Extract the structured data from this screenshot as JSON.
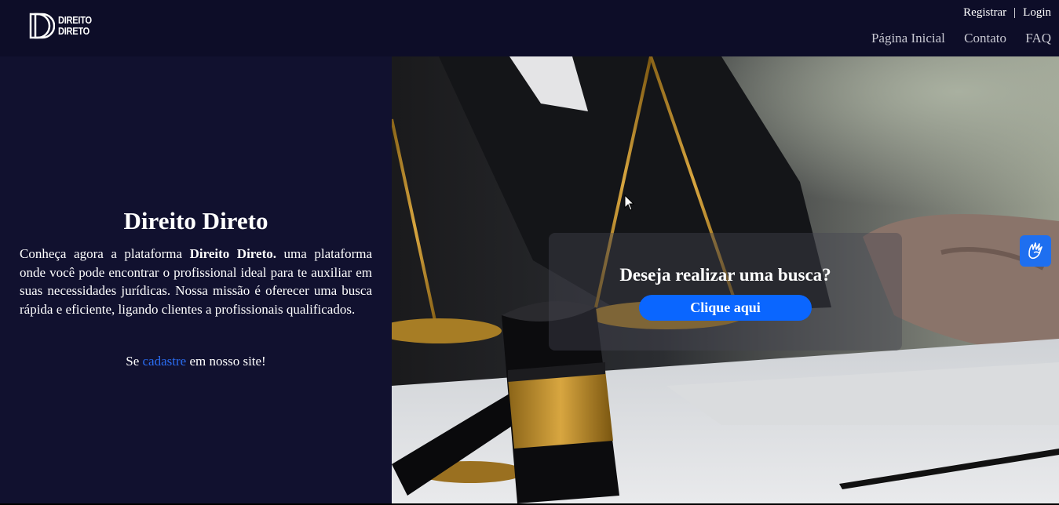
{
  "header": {
    "logo_alt": "Direito Direto logo",
    "logo_line1": "DIREITO",
    "logo_line2": "DIRETO",
    "auth": {
      "register": "Registrar",
      "separator": "|",
      "login": "Login"
    },
    "nav": [
      "Página Inicial",
      "Contato",
      "FAQ"
    ]
  },
  "intro": {
    "title": "Direito Direto",
    "desc_prefix": "Conheça agora a plataforma ",
    "desc_brand": "Direito Direto.",
    "desc_suffix": " uma plataforma onde você pode encontrar o profissional ideal para te auxiliar em suas necessidades jurídicas. Nossa missão é oferecer uma busca rápida e eficiente, ligando clientes a profissionais qualificados.",
    "signup_prefix": "Se ",
    "signup_link": "cadastre",
    "signup_suffix": " em nosso site!"
  },
  "search": {
    "question": "Deseja realizar uma busca?",
    "button": "Clique aqui"
  },
  "colors": {
    "header_bg": "#0d0d28",
    "panel_bg": "#11112f",
    "accent_button": "#0a66ff",
    "link": "#2a6cf0",
    "accessibility_button": "#1e6ff0"
  },
  "icons": {
    "accessibility": "sign-language-hand-icon"
  }
}
